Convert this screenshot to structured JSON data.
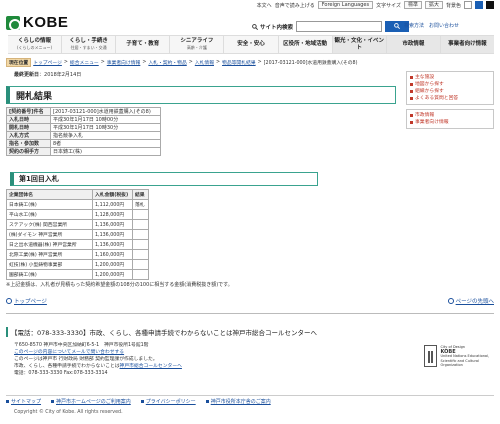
{
  "utility": {
    "items": [
      "本文へ",
      "音声で読み上げる",
      "Foreign Languages",
      "文字サイズ",
      "標準",
      "拡大",
      "背景色"
    ]
  },
  "header": {
    "logo_text": "KOBE",
    "search_label": "サイト内検索",
    "search_button": "検索",
    "tools": [
      "検索方法",
      "お問い合わせ"
    ]
  },
  "gnav": [
    {
      "label": "くらしの情報",
      "sub": "(くらしのメニュー)"
    },
    {
      "label": "くらし・手続き",
      "sub": "住居・すまい・交通"
    },
    {
      "label": "子育て・教育",
      "sub": ""
    },
    {
      "label": "シニアライフ",
      "sub": "高齢・介護"
    },
    {
      "label": "安全・安心",
      "sub": ""
    },
    {
      "label": "区役所・地域活動",
      "sub": ""
    },
    {
      "label": "観光・文化・イベント",
      "sub": ""
    },
    {
      "label": "市政情報",
      "sub": ""
    },
    {
      "label": "事業者向け情報",
      "sub": ""
    }
  ],
  "breadcrumb": {
    "here": "現在位置",
    "items": [
      "トップページ",
      "総合メニュー",
      "事業者向け情報",
      "入札・契約・物品",
      "入札情報",
      "物品等開札結果",
      "[2017-03121-000]水道用鉄蓋購入(その8)"
    ]
  },
  "updated": {
    "label": "最終更新日",
    "value": "2018年2月14日"
  },
  "title": "開札結果",
  "side": {
    "box1": [
      "主な施設",
      "地図から探す",
      "組織から探す",
      "よくある質問と回答"
    ],
    "box2": [
      "市政情報",
      "事業者向け情報"
    ]
  },
  "info_rows": [
    {
      "k": "[契約番号]件名",
      "v": "[2017-03121-000]水道用鉄蓋購入(その8)"
    },
    {
      "k": "入札日時",
      "v": "平成30年1月17日 10時00分"
    },
    {
      "k": "開札日時",
      "v": "平成30年1月17日 10時30分"
    },
    {
      "k": "入札方式",
      "v": "指名競争入札"
    },
    {
      "k": "指名・参加数",
      "v": "8者"
    },
    {
      "k": "契約の相手方",
      "v": "日本鋳工(株)"
    }
  ],
  "round_title": "第1回目入札",
  "result": {
    "headers": [
      "企業団体名",
      "入札金額(税抜)",
      "結果"
    ],
    "rows": [
      [
        "日本鋳工(株)",
        "1,112,000円",
        "落札"
      ],
      [
        "平山水工(株)",
        "1,128,000円",
        ""
      ],
      [
        "ステアック(株) 関西営業所",
        "1,136,000円",
        ""
      ],
      [
        "(株)ダイモン 神戸営業所",
        "1,136,000円",
        ""
      ],
      [
        "日之出水道機器(株) 神戸営業所",
        "1,136,000円",
        ""
      ],
      [
        "北際工業(株) 神戸営業所",
        "1,160,000円",
        ""
      ],
      [
        "虹技(株) 小型鋳物事業部",
        "1,200,000円",
        ""
      ],
      [
        "園部鋳工(株)",
        "1,200,000円",
        ""
      ]
    ]
  },
  "note": "※上記金額は、入札者が見積もった契約希望金額の108分の100に相当する金額(消費税抜き額)です。",
  "pager": {
    "prev": "トップページ",
    "next": "ページの先頭へ"
  },
  "callcenter": "【電話：078-333-3330】市政、くらし、各種申請手続でわからないことは神戸市総合コールセンターへ",
  "footer": {
    "addr1": "〒650-8570 神戸市中央区加納町6-5-1　神戸市役所1号館1階",
    "link1": "このページの内容についてメールで問い合わせする",
    "dept": "このページは神戸市 行財政局 財務部 契約監理課が作成しました。",
    "line3": "市政、くらし、各種申請手続でわからないことは",
    "line3_link": "神戸市総合コールセンターへ",
    "tel": "電話：078-333-3330 Fax:078-333-3314",
    "unesco": [
      "City of Design",
      "KOBE",
      "United Nations Educational, Scientific and Cultural Organization"
    ]
  },
  "footer_links": [
    "サイトマップ",
    "神戸市ホームページのご利用案内",
    "プライバシーポリシー",
    "神戸市役所本庁舎のご案内"
  ],
  "copyright": "Copyright © City of Kobe. All rights reserved.",
  "colors": {
    "accent": "#2a8f7b",
    "link": "#1a4f9c",
    "brand": "#1f8a3b"
  }
}
